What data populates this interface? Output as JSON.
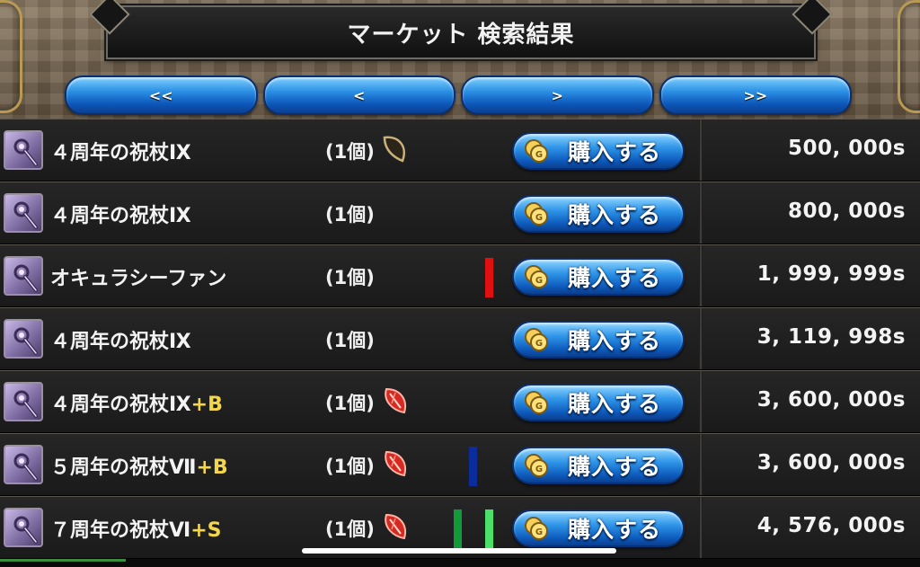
{
  "header": {
    "title": "マーケット 検索結果"
  },
  "pager": {
    "first_label": "<<",
    "prev_label": "<",
    "next_label": ">",
    "last_label": ">>"
  },
  "buy_label": "購入する",
  "colors": {
    "marker_red": "#e01010",
    "marker_blue": "#0a2c9c",
    "marker_green_dark": "#129a3a",
    "marker_green_light": "#4be06a",
    "suffix_yellow": "#f4d64a"
  },
  "listings": [
    {
      "name": "４周年の祝杖Ⅸ",
      "suffix": "",
      "qty": "(1個)",
      "gem": "brown",
      "markers": [],
      "price": "500, 000s"
    },
    {
      "name": "４周年の祝杖Ⅸ",
      "suffix": "",
      "qty": "(1個)",
      "gem": "none",
      "markers": [],
      "price": "800, 000s"
    },
    {
      "name": "オキュラシーファン",
      "suffix": "",
      "qty": "(1個)",
      "gem": "none",
      "markers": [
        "red"
      ],
      "price": "1, 999, 999s"
    },
    {
      "name": "４周年の祝杖Ⅸ",
      "suffix": "",
      "qty": "(1個)",
      "gem": "none",
      "markers": [],
      "price": "3, 119, 998s"
    },
    {
      "name": "４周年の祝杖Ⅸ",
      "suffix": "+B",
      "qty": "(1個)",
      "gem": "red",
      "markers": [],
      "price": "3, 600, 000s"
    },
    {
      "name": "５周年の祝杖Ⅶ",
      "suffix": "+B",
      "qty": "(1個)",
      "gem": "red",
      "markers": [
        "blue"
      ],
      "price": "3, 600, 000s"
    },
    {
      "name": "７周年の祝杖Ⅵ",
      "suffix": "+S",
      "qty": "(1個)",
      "gem": "red",
      "markers": [
        "green-dark",
        "green-light"
      ],
      "price": "4, 576, 000s"
    }
  ]
}
